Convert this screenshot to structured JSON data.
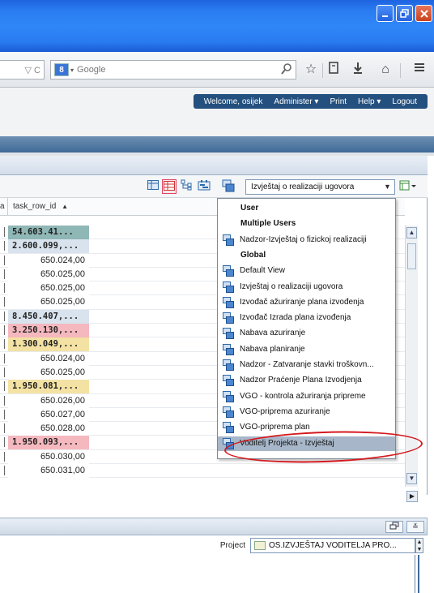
{
  "browser": {
    "url_tail": "▽ C",
    "search_engine_badge": "8",
    "search_placeholder": "Google"
  },
  "app_nav": {
    "welcome": "Welcome, osijek",
    "administer": "Administer ▾",
    "print": "Print",
    "help": "Help ▾",
    "logout": "Logout"
  },
  "grid": {
    "col_a": "a",
    "col_task": "task_row_id",
    "sort_indicator": "▲",
    "rows": [
      {
        "marker": "",
        "value": "54.603.41...",
        "bold": true,
        "bg": "#8fb7b5"
      },
      {
        "marker": "",
        "value": "2.600.099,...",
        "bold": true,
        "bg": "#d9e3ee"
      },
      {
        "marker": "",
        "value": "650.024,00",
        "bold": false,
        "bg": "#ffffff"
      },
      {
        "marker": "",
        "value": "650.025,00",
        "bold": false,
        "bg": "#ffffff"
      },
      {
        "marker": "",
        "value": "650.025,00",
        "bold": false,
        "bg": "#ffffff"
      },
      {
        "marker": "",
        "value": "650.025,00",
        "bold": false,
        "bg": "#ffffff"
      },
      {
        "marker": "",
        "value": "8.450.407,...",
        "bold": true,
        "bg": "#d9e3ee"
      },
      {
        "marker": "",
        "value": "3.250.130,...",
        "bold": true,
        "bg": "#f4b8be"
      },
      {
        "marker": "",
        "value": "1.300.049,...",
        "bold": true,
        "bg": "#f3e2a3"
      },
      {
        "marker": "",
        "value": "650.024,00",
        "bold": false,
        "bg": "#ffffff"
      },
      {
        "marker": "",
        "value": "650.025,00",
        "bold": false,
        "bg": "#ffffff"
      },
      {
        "marker": "",
        "value": "1.950.081,...",
        "bold": true,
        "bg": "#f3e2a3"
      },
      {
        "marker": "",
        "value": "650.026,00",
        "bold": false,
        "bg": "#ffffff"
      },
      {
        "marker": "",
        "value": "650.027,00",
        "bold": false,
        "bg": "#ffffff"
      },
      {
        "marker": "",
        "value": "650.028,00",
        "bold": false,
        "bg": "#ffffff"
      },
      {
        "marker": "",
        "value": "1.950.093,...",
        "bold": true,
        "bg": "#f4b8be"
      },
      {
        "marker": "",
        "value": "650.030,00",
        "bold": false,
        "bg": "#ffffff"
      },
      {
        "marker": "",
        "value": "650.031,00",
        "bold": false,
        "bg": "#ffffff"
      }
    ]
  },
  "view_selector": {
    "selected": "Izvještaj o realizaciji ugovora"
  },
  "dropdown": {
    "items": [
      {
        "label": "User",
        "type": "section"
      },
      {
        "label": "Multiple Users",
        "type": "section"
      },
      {
        "label": "Nadzor-Izvještaj o fizickoj realizaciji",
        "type": "item"
      },
      {
        "label": "Global",
        "type": "section"
      },
      {
        "label": "Default View",
        "type": "item"
      },
      {
        "label": "Izvještaj o realizaciji ugovora",
        "type": "item"
      },
      {
        "label": "Izvođač ažuriranje plana izvođenja",
        "type": "item"
      },
      {
        "label": "Izvođač Izrada plana izvođenja",
        "type": "item"
      },
      {
        "label": "Nabava azuriranje",
        "type": "item"
      },
      {
        "label": "Nabava planiranje",
        "type": "item"
      },
      {
        "label": "Nadzor - Zatvaranje stavki troškovn...",
        "type": "item"
      },
      {
        "label": "Nadzor Praćenje Plana Izvodjenja",
        "type": "item"
      },
      {
        "label": "VGO - kontrola ažuriranja pripreme",
        "type": "item"
      },
      {
        "label": "VGO-priprema azuriranje",
        "type": "item"
      },
      {
        "label": "VGO-priprema plan",
        "type": "item"
      },
      {
        "label": "Voditelj Projekta - Izvještaj",
        "type": "item",
        "highlighted": true
      }
    ]
  },
  "bottom": {
    "project_label": "Project",
    "project_value": "OS.IZVJEŠTAJ VODITELJA PRO..."
  },
  "colors": {
    "title_bar": "#2f87f7",
    "app_nav": "#24507f",
    "highlight": "#a7b7c9",
    "annotation": "#d4191e"
  }
}
